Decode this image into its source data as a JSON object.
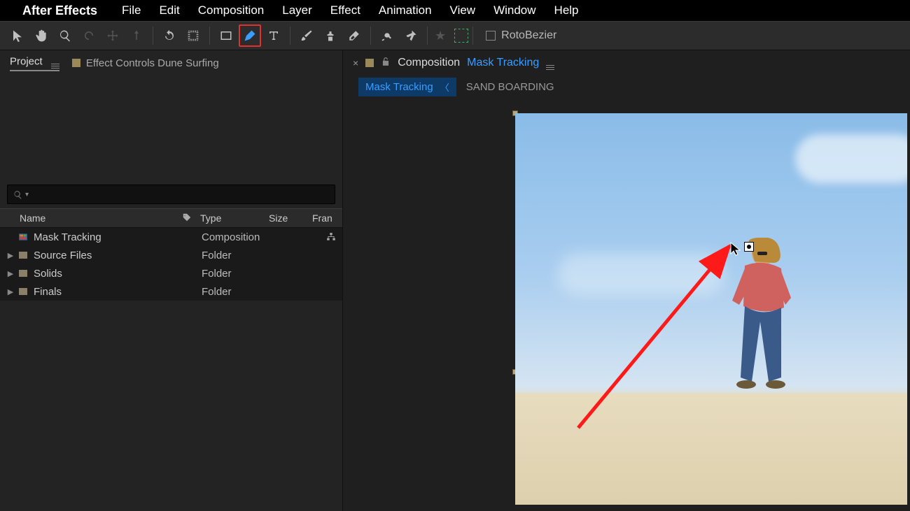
{
  "menubar": {
    "app_name": "After Effects",
    "items": [
      "File",
      "Edit",
      "Composition",
      "Layer",
      "Effect",
      "Animation",
      "View",
      "Window",
      "Help"
    ]
  },
  "toolbar": {
    "rotobezier_label": "RotoBezier"
  },
  "project_panel": {
    "tab_project": "Project",
    "tab_effect_controls": "Effect Controls Dune Surfing",
    "search_placeholder": "",
    "columns": {
      "name": "Name",
      "type": "Type",
      "size": "Size",
      "fran": "Fran"
    },
    "rows": [
      {
        "name": "Mask Tracking",
        "type": "Composition",
        "kind": "comp",
        "tag": "tan",
        "flow": true
      },
      {
        "name": "Source Files",
        "type": "Folder",
        "kind": "folder",
        "tag": "yellow"
      },
      {
        "name": "Solids",
        "type": "Folder",
        "kind": "folder",
        "tag": "yellow"
      },
      {
        "name": "Finals",
        "type": "Folder",
        "kind": "folder",
        "tag": "yellow"
      }
    ]
  },
  "comp_panel": {
    "label": "Composition",
    "name": "Mask Tracking",
    "crumb_active": "Mask Tracking",
    "crumb_next": "SAND BOARDING"
  }
}
